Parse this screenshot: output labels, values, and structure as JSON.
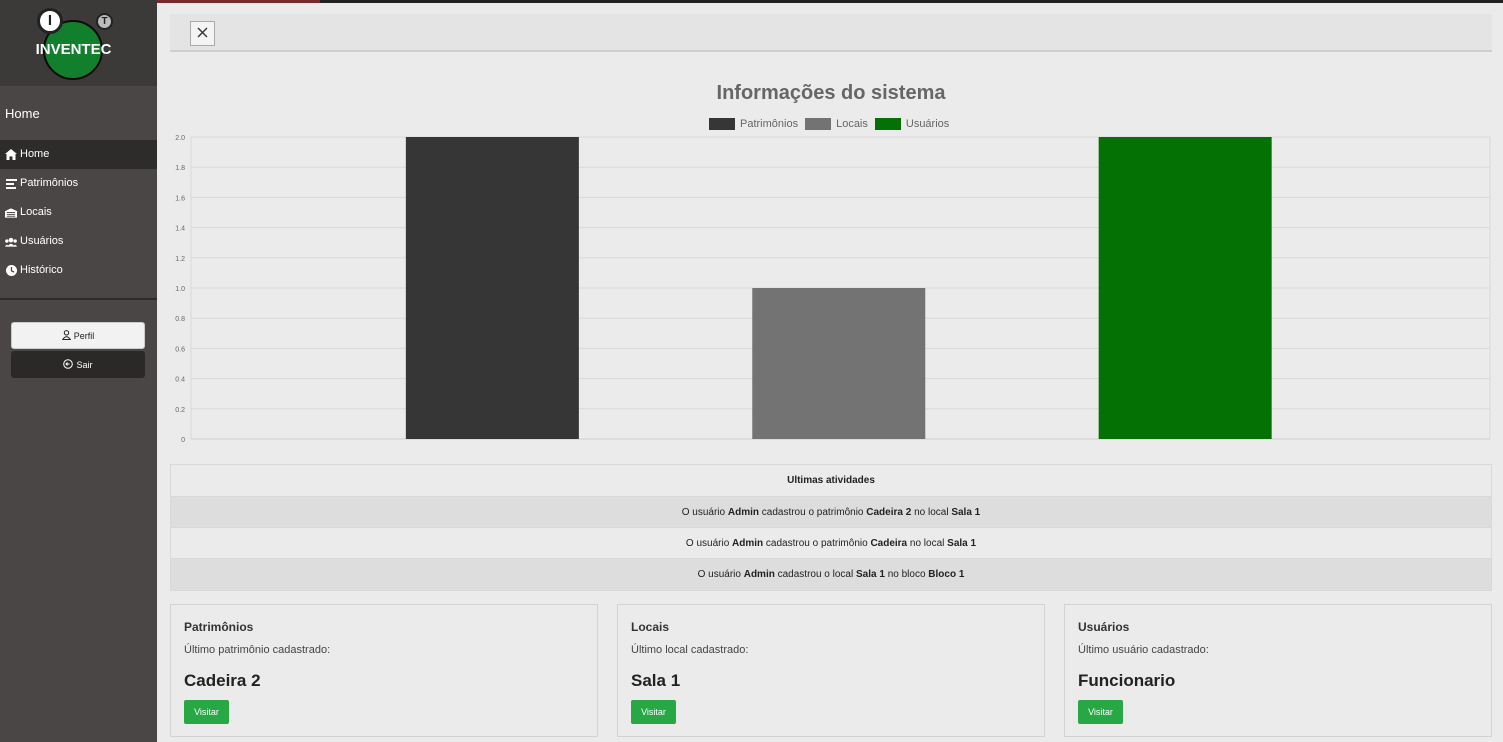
{
  "brand": {
    "name": "INVENTEC",
    "logo_i": "I",
    "logo_t": "T"
  },
  "sidebar": {
    "title": "Home",
    "items": [
      {
        "label": "Home",
        "icon": "home-icon",
        "active": true
      },
      {
        "label": "Patrimônios",
        "icon": "list-icon",
        "active": false
      },
      {
        "label": "Locais",
        "icon": "building-icon",
        "active": false
      },
      {
        "label": "Usuários",
        "icon": "users-icon",
        "active": false
      },
      {
        "label": "Histórico",
        "icon": "clock-icon",
        "active": false
      }
    ],
    "profile_label": "Perfil",
    "logout_label": "Sair"
  },
  "topbar": {
    "close_icon": "close-icon"
  },
  "chart_data": {
    "type": "bar",
    "title": "Informações do sistema",
    "series": [
      {
        "name": "Patrimônios",
        "values": [
          2
        ],
        "color": "#363636"
      },
      {
        "name": "Locais",
        "values": [
          1
        ],
        "color": "#737373"
      },
      {
        "name": "Usuários",
        "values": [
          2
        ],
        "color": "#037103"
      }
    ],
    "y_ticks": [
      "0",
      "0.2",
      "0.4",
      "0.6",
      "0.8",
      "1.0",
      "1.2",
      "1.4",
      "1.6",
      "1.8",
      "2.0"
    ],
    "ylim": [
      0,
      2
    ],
    "grid": true,
    "legend_position": "top"
  },
  "activities": {
    "header": "Ultimas atividades",
    "rows": [
      {
        "p1": "O usuário ",
        "b1": "Admin",
        "p2": " cadastrou o patrimônio ",
        "b2": "Cadeira 2",
        "p3": " no local ",
        "b3": "Sala 1"
      },
      {
        "p1": "O usuário ",
        "b1": "Admin",
        "p2": " cadastrou o patrimônio ",
        "b2": "Cadeira",
        "p3": " no local ",
        "b3": "Sala 1"
      },
      {
        "p1": "O usuário ",
        "b1": "Admin",
        "p2": " cadastrou o local ",
        "b2": "Sala 1",
        "p3": " no bloco ",
        "b3": "Bloco 1"
      }
    ]
  },
  "cards": [
    {
      "title": "Patrimônios",
      "subtitle": "Último patrimônio cadastrado:",
      "value": "Cadeira 2",
      "button": "Visitar"
    },
    {
      "title": "Locais",
      "subtitle": "Último local cadastrado:",
      "value": "Sala 1",
      "button": "Visitar"
    },
    {
      "title": "Usuários",
      "subtitle": "Último usuário cadastrado:",
      "value": "Funcionario",
      "button": "Visitar"
    }
  ]
}
